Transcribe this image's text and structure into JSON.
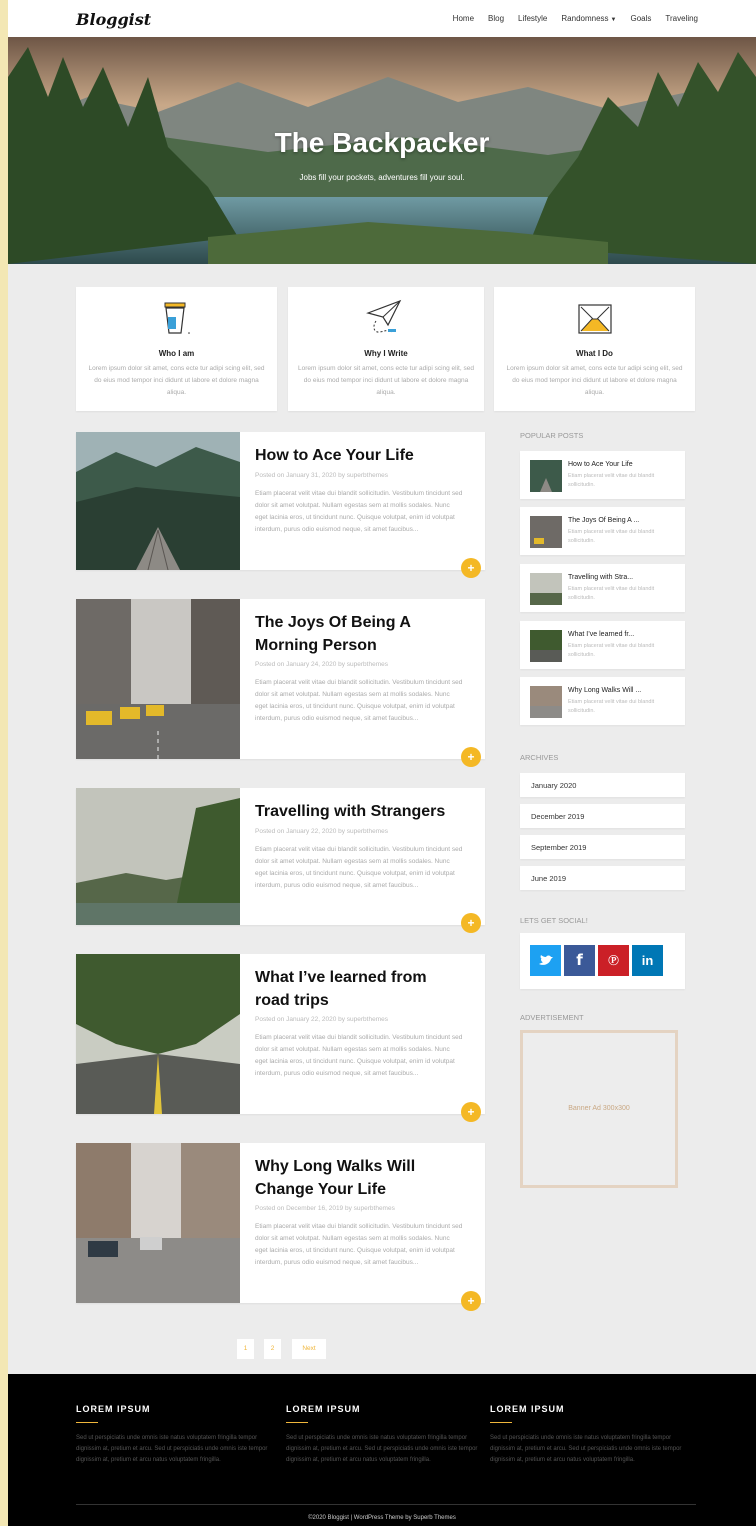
{
  "header": {
    "logo": "Bloggist",
    "nav": [
      "Home",
      "Blog",
      "Lifestyle",
      "Randomness",
      "Goals",
      "Traveling"
    ]
  },
  "hero": {
    "title": "The Backpacker",
    "subtitle": "Jobs fill your pockets, adventures fill your soul."
  },
  "features": [
    {
      "icon": "coffee-cup-icon",
      "title": "Who I am",
      "text": "Lorem ipsum dolor sit amet, cons ecte tur adipi scing elit, sed do eius mod tempor inci didunt ut labore et dolore magna aliqua."
    },
    {
      "icon": "paper-plane-icon",
      "title": "Why I Write",
      "text": "Lorem ipsum dolor sit amet, cons ecte tur adipi scing elit, sed do eius mod tempor inci didunt ut labore et dolore magna aliqua."
    },
    {
      "icon": "envelope-icon",
      "title": "What I Do",
      "text": "Lorem ipsum dolor sit amet, cons ecte tur adipi scing elit, sed do eius mod tempor inci didunt ut labore et dolore magna aliqua."
    }
  ],
  "posts": [
    {
      "title": "How to Ace Your Life",
      "meta": "Posted on January 31, 2020 by superbthemes",
      "excerpt": "Etiam placerat velit vitae dui blandit sollicitudin. Vestibulum tincidunt sed dolor sit amet volutpat. Nullam egestas sem at mollis sodales. Nunc eget lacinia eros, ut tincidunt nunc. Quisque volutpat, enim id volutpat interdum, purus odio euismod neque, sit amet faucibus..."
    },
    {
      "title": "The Joys Of Being A Morning Person",
      "meta": "Posted on January 24, 2020 by superbthemes",
      "excerpt": "Etiam placerat velit vitae dui blandit sollicitudin. Vestibulum tincidunt sed dolor sit amet volutpat. Nullam egestas sem at mollis sodales. Nunc eget lacinia eros, ut tincidunt nunc. Quisque volutpat, enim id volutpat interdum, purus odio euismod neque, sit amet faucibus..."
    },
    {
      "title": "Travelling with Strangers",
      "meta": "Posted on January 22, 2020 by superbthemes",
      "excerpt": "Etiam placerat velit vitae dui blandit sollicitudin. Vestibulum tincidunt sed dolor sit amet volutpat. Nullam egestas sem at mollis sodales. Nunc eget lacinia eros, ut tincidunt nunc. Quisque volutpat, enim id volutpat interdum, purus odio euismod neque, sit amet faucibus..."
    },
    {
      "title": "What I’ve learned from road trips",
      "meta": "Posted on January 22, 2020 by superbthemes",
      "excerpt": "Etiam placerat velit vitae dui blandit sollicitudin. Vestibulum tincidunt sed dolor sit amet volutpat. Nullam egestas sem at mollis sodales. Nunc eget lacinia eros, ut tincidunt nunc. Quisque volutpat, enim id volutpat interdum, purus odio euismod neque, sit amet faucibus..."
    },
    {
      "title": "Why Long Walks Will Change Your Life",
      "meta": "Posted on December 16, 2019 by superbthemes",
      "excerpt": "Etiam placerat velit vitae dui blandit sollicitudin. Vestibulum tincidunt sed dolor sit amet volutpat. Nullam egestas sem at mollis sodales. Nunc eget lacinia eros, ut tincidunt nunc. Quisque volutpat, enim id volutpat interdum, purus odio euismod neque, sit amet faucibus..."
    }
  ],
  "read_more_icon": "+",
  "sidebar": {
    "popular_title": "POPULAR POSTS",
    "popular": [
      {
        "title": "How to Ace Your Life",
        "excerpt": "Etiam placerat velit vitae dui blandit sollicitudin."
      },
      {
        "title": "The Joys Of Being A ...",
        "excerpt": "Etiam placerat velit vitae dui blandit sollicitudin."
      },
      {
        "title": "Travelling with Stra...",
        "excerpt": "Etiam placerat velit vitae dui blandit sollicitudin."
      },
      {
        "title": "What I’ve learned fr...",
        "excerpt": "Etiam placerat velit vitae dui blandit sollicitudin."
      },
      {
        "title": "Why Long Walks Will ...",
        "excerpt": "Etiam placerat velit vitae dui blandit sollicitudin."
      }
    ],
    "archives_title": "ARCHIVES",
    "archives": [
      "January 2020",
      "December 2019",
      "September 2019",
      "June 2019"
    ],
    "social_title": "LETS GET SOCIAL!",
    "social": [
      {
        "name": "twitter",
        "glyph": "🐦",
        "color": "#1da1f2"
      },
      {
        "name": "facebook",
        "glyph": "f",
        "color": "#3b5998"
      },
      {
        "name": "pinterest",
        "glyph": "P",
        "color": "#cb2027"
      },
      {
        "name": "linkedin",
        "glyph": "in",
        "color": "#0077b5"
      }
    ],
    "ad_title": "ADVERTISEMENT",
    "ad_text": "Banner Ad 300x300"
  },
  "pagination": [
    "1",
    "2",
    "Next"
  ],
  "footer": {
    "columns": [
      {
        "title": "LOREM IPSUM",
        "text": "Sed ut perspiciatis unde omnis iste natus voluptatem fringilla tempor dignissim at, pretium et arcu. Sed ut perspiciatis unde omnis iste tempor dignissim at, pretium et arcu natus voluptatem fringilla."
      },
      {
        "title": "LOREM IPSUM",
        "text": "Sed ut perspiciatis unde omnis iste natus voluptatem fringilla tempor dignissim at, pretium et arcu. Sed ut perspiciatis unde omnis iste tempor dignissim at, pretium et arcu natus voluptatem fringilla."
      },
      {
        "title": "LOREM IPSUM",
        "text": "Sed ut perspiciatis unde omnis iste natus voluptatem fringilla tempor dignissim at, pretium et arcu. Sed ut perspiciatis unde omnis iste tempor dignissim at, pretium et arcu natus voluptatem fringilla."
      }
    ],
    "copyright": "©2020 Bloggist | WordPress Theme by Superb Themes"
  },
  "colors": {
    "accent": "#f4b825",
    "footer_bg": "#000000",
    "page_bg": "#ececec"
  }
}
